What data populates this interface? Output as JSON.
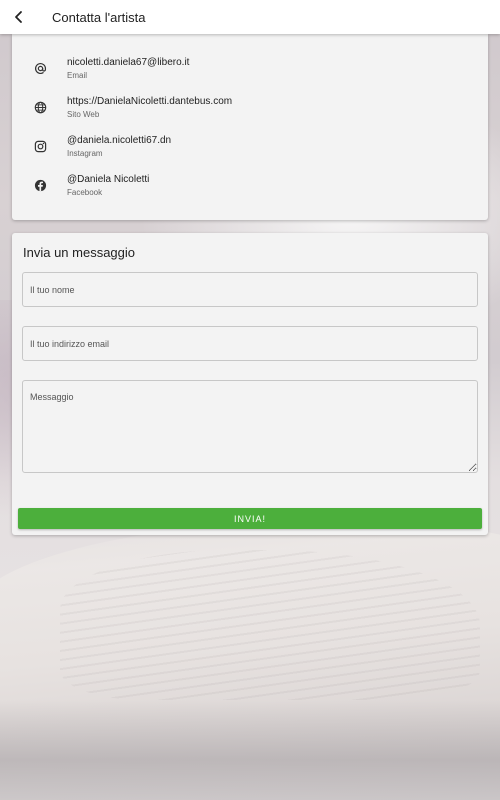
{
  "appbar": {
    "title": "Contatta l'artista"
  },
  "contacts": [
    {
      "icon": "at-icon",
      "value": "nicoletti.daniela67@libero.it",
      "label": "Email"
    },
    {
      "icon": "globe-icon",
      "value": "https://DanielaNicoletti.dantebus.com",
      "label": "Sito Web"
    },
    {
      "icon": "instagram-icon",
      "value": "@daniela.nicoletti67.dn",
      "label": "Instagram"
    },
    {
      "icon": "facebook-icon",
      "value": "@Daniela Nicoletti",
      "label": "Facebook"
    }
  ],
  "message_form": {
    "title": "Invia un messaggio",
    "name_placeholder": "Il tuo nome",
    "email_placeholder": "Il tuo indirizzo email",
    "message_placeholder": "Messaggio",
    "send_label": "INVIA!"
  },
  "colors": {
    "accent": "#4caf3c",
    "card": "#f3f3f3"
  }
}
